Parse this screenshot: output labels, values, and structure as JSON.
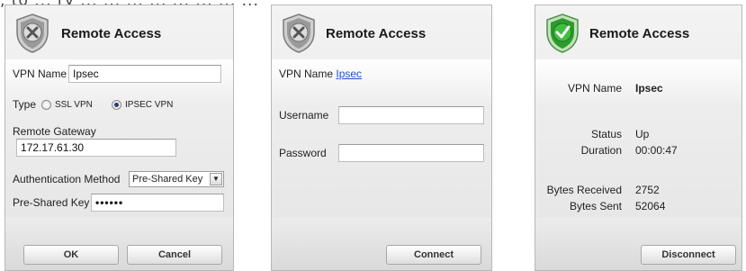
{
  "top_fragment": ", to ... ry ... ...   ...       ...  ...   ... ... ...",
  "panels": [
    {
      "title": "Remote Access",
      "shield_state": "gray",
      "vpn_name_label": "VPN Name",
      "vpn_name_value": "Ipsec",
      "type_label": "Type",
      "type_options": [
        "SSL VPN",
        "IPSEC VPN"
      ],
      "type_selected": "IPSEC VPN",
      "remote_gateway_label": "Remote Gateway",
      "remote_gateway_value": "172.17.61.30",
      "auth_method_label": "Authentication Method",
      "auth_method_value": "Pre-Shared Key",
      "psk_label": "Pre-Shared Key",
      "psk_value": "••••••",
      "ok_label": "OK",
      "cancel_label": "Cancel"
    },
    {
      "title": "Remote Access",
      "shield_state": "gray",
      "vpn_name_label": "VPN Name",
      "vpn_name_value": "Ipsec",
      "username_label": "Username",
      "username_value": "",
      "password_label": "Password",
      "password_value": "",
      "connect_label": "Connect"
    },
    {
      "title": "Remote Access",
      "shield_state": "green",
      "vpn_name_label": "VPN Name",
      "vpn_name_value": "Ipsec",
      "status_label": "Status",
      "status_value": "Up",
      "duration_label": "Duration",
      "duration_value": "00:00:47",
      "bytes_received_label": "Bytes Received",
      "bytes_received_value": "2752",
      "bytes_sent_label": "Bytes Sent",
      "bytes_sent_value": "52064",
      "disconnect_label": "Disconnect"
    }
  ],
  "colors": {
    "shield_gray": "#8a8a8a",
    "shield_green": "#2e9a2e",
    "link": "#1a55cc",
    "panel_bg": "#f3f3f3"
  }
}
